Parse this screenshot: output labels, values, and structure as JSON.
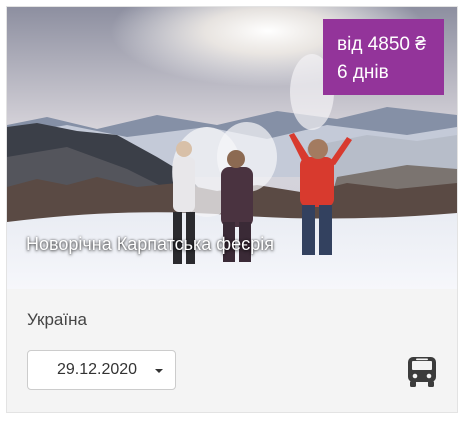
{
  "tour": {
    "title": "Новорічна Карпатська феєрія",
    "price_label": "від 4850 ₴",
    "duration_label": "6 днів",
    "country": "Україна",
    "selected_date": "29.12.2020",
    "transport_icon": "bus-icon"
  },
  "colors": {
    "badge_bg": "#93349a",
    "card_bg": "#f4f4f4",
    "text": "#444444"
  }
}
